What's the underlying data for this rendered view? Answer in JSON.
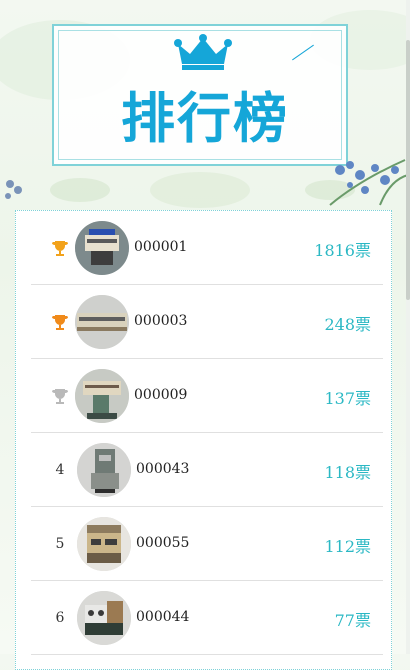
{
  "header": {
    "title": "排行榜",
    "icon": "crown-icon"
  },
  "ranking": {
    "vote_unit": "票",
    "items": [
      {
        "rank": "",
        "rank_icon": "gold-trophy-icon",
        "id": "000001",
        "votes": "1816票"
      },
      {
        "rank": "",
        "rank_icon": "bronze-trophy-icon",
        "id": "000003",
        "votes": "248票"
      },
      {
        "rank": "",
        "rank_icon": "silver-trophy-icon",
        "id": "000009",
        "votes": "137票"
      },
      {
        "rank": "4",
        "rank_icon": "",
        "id": "000043",
        "votes": "118票"
      },
      {
        "rank": "5",
        "rank_icon": "",
        "id": "000055",
        "votes": "112票"
      },
      {
        "rank": "6",
        "rank_icon": "",
        "id": "000044",
        "votes": "77票"
      }
    ]
  },
  "colors": {
    "accent": "#15a6d8",
    "frame": "#7fd2d8",
    "votes": "#2bb8c4",
    "gold": "#f2a21b",
    "bronze": "#f08a1a",
    "silver": "#b9b9b9"
  }
}
